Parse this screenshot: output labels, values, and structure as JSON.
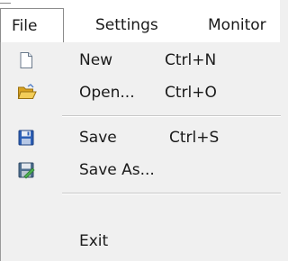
{
  "menubar": {
    "items": [
      {
        "label": "File"
      },
      {
        "label": "Settings"
      },
      {
        "label": "Monitor"
      }
    ]
  },
  "file_menu": {
    "items": [
      {
        "label": "New",
        "shortcut": "Ctrl+N",
        "icon": "new-document-icon"
      },
      {
        "label": "Open...",
        "shortcut": "Ctrl+O",
        "icon": "open-folder-icon"
      },
      {
        "label": "Save",
        "shortcut": "Ctrl+S",
        "icon": "save-disk-icon"
      },
      {
        "label": "Save As...",
        "shortcut": "",
        "icon": "save-as-icon"
      },
      {
        "label": "Exit",
        "shortcut": "",
        "icon": ""
      }
    ]
  },
  "colors": {
    "menu_background": "#f0f0f0",
    "menubar_background": "#ffffff",
    "separator": "#c8c8c8",
    "folder_yellow": "#e8b83a",
    "disk_blue": "#2c5fb5"
  }
}
